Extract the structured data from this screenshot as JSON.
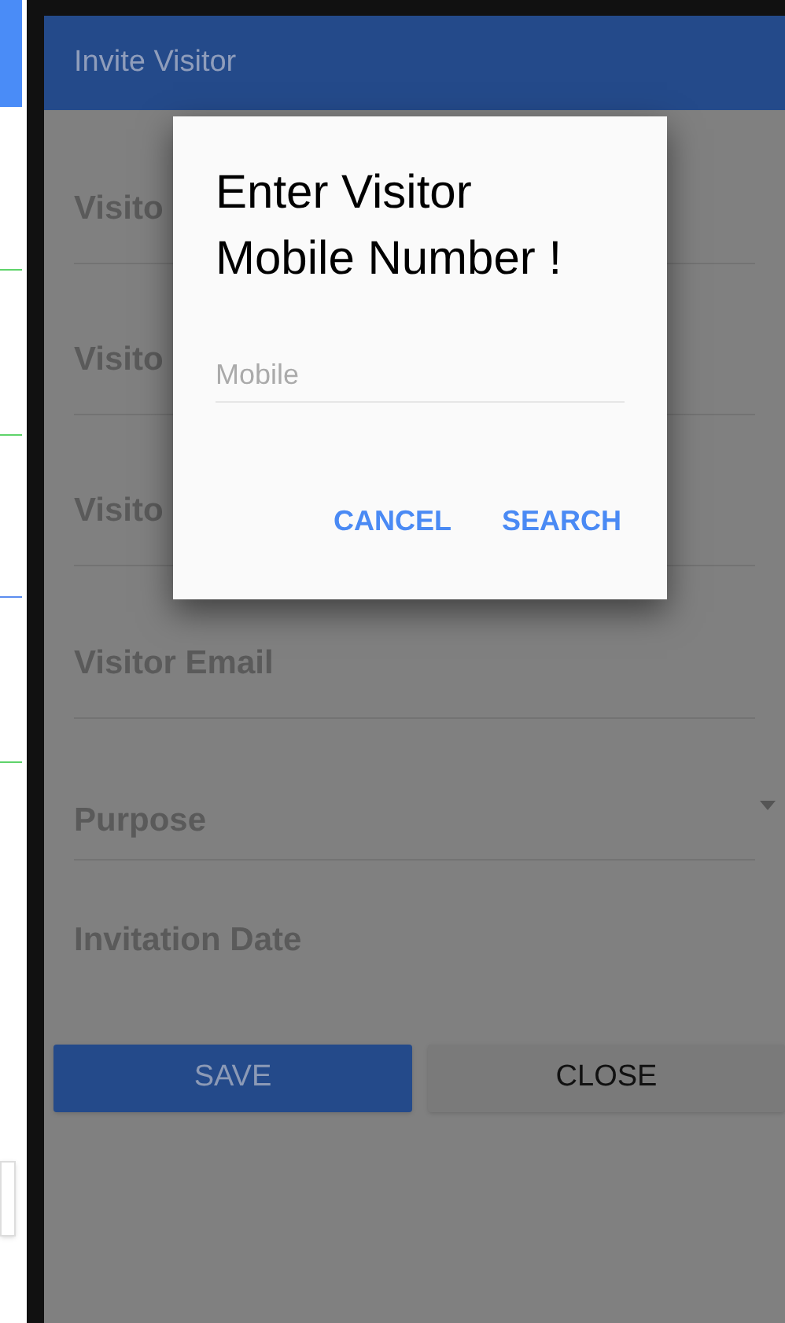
{
  "app_bar": {
    "title": "Invite Visitor"
  },
  "fields": [
    {
      "kind": "text",
      "label": "Visito"
    },
    {
      "kind": "text",
      "label": "Visito"
    },
    {
      "kind": "text",
      "label": "Visito"
    },
    {
      "kind": "text",
      "label": "Visitor Email"
    },
    {
      "kind": "dropdown",
      "label": "Purpose"
    },
    {
      "kind": "date",
      "label": "Invitation Date"
    }
  ],
  "buttons": [
    {
      "kind": "primary",
      "label": "SAVE"
    },
    {
      "kind": "secondary",
      "label": "CLOSE"
    }
  ],
  "dialog": {
    "title": "Enter Visitor Mobile Number !",
    "field": {
      "placeholder": "Mobile"
    },
    "actions": [
      "CANCEL",
      "SEARCH"
    ]
  }
}
